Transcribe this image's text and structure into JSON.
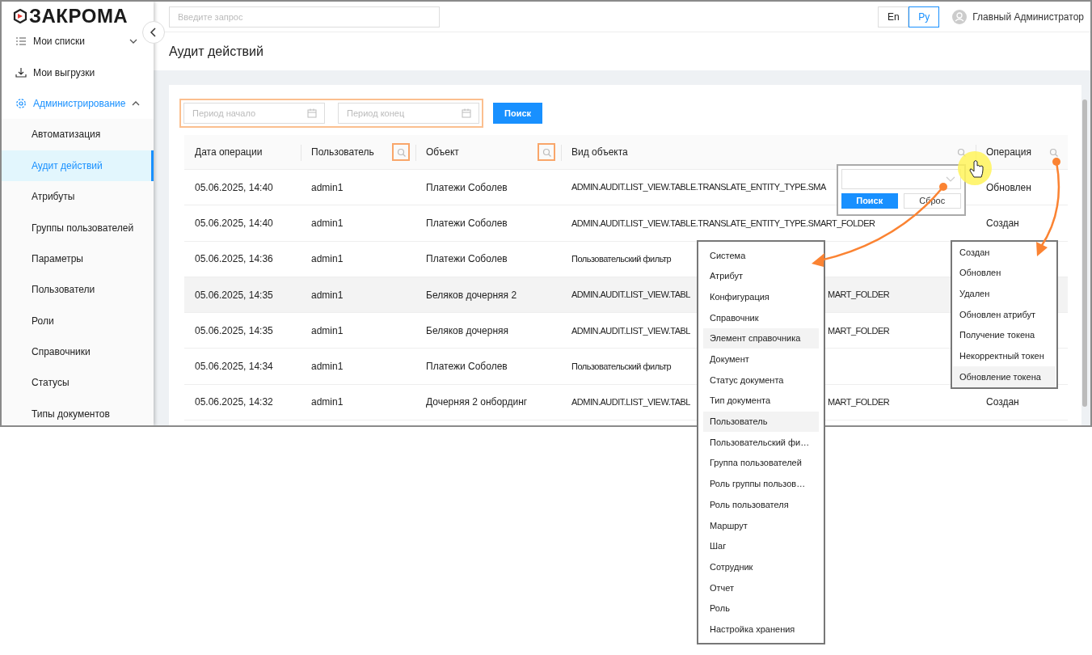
{
  "app": {
    "logo": "ЗАКРОМА"
  },
  "header": {
    "search": {
      "placeholder": "Введите запрос"
    },
    "languages": [
      {
        "label": "En",
        "selected": false
      },
      {
        "label": "Ру",
        "selected": true
      }
    ],
    "user": "Главный Администратор"
  },
  "sidebar": {
    "items": [
      {
        "label": "Мои списки",
        "kind": "list",
        "expanded": false,
        "selected": false
      },
      {
        "label": "Мои выгрузки",
        "kind": "download",
        "selected": false
      },
      {
        "label": "Администрирование",
        "kind": "gear",
        "expanded": true,
        "selected": true,
        "children": [
          {
            "label": "Автоматизация",
            "selected": false
          },
          {
            "label": "Аудит действий",
            "selected": true
          },
          {
            "label": "Атрибуты",
            "selected": false
          },
          {
            "label": "Группы пользователей",
            "selected": false
          },
          {
            "label": "Параметры",
            "selected": false
          },
          {
            "label": "Пользователи",
            "selected": false
          },
          {
            "label": "Роли",
            "selected": false
          },
          {
            "label": "Справочники",
            "selected": false
          },
          {
            "label": "Статусы",
            "selected": false
          },
          {
            "label": "Типы документов",
            "selected": false
          }
        ]
      }
    ]
  },
  "page": {
    "title": "Аудит действий"
  },
  "filters": {
    "marked": true,
    "start": {
      "placeholder": "Период начало"
    },
    "end": {
      "placeholder": "Период конец"
    },
    "search_button": "Поиск"
  },
  "table": {
    "columns": [
      {
        "label": "Дата операции",
        "filter": false
      },
      {
        "label": "Пользователь",
        "filter": true,
        "marked": true
      },
      {
        "label": "Объект",
        "filter": true,
        "marked": true
      },
      {
        "label": "Вид объекта",
        "filter": true,
        "marked": false
      },
      {
        "label": "Операция",
        "filter": true,
        "marked": false
      }
    ],
    "rows": [
      {
        "hovered": false,
        "cells": [
          "05.06.2025, 14:40",
          "admin1",
          "Платежи Соболев",
          "ADMIN.AUDIT.LIST_VIEW.TABLE.TRANSLATE_ENTITY_TYPE.SMA",
          "Обновлен"
        ]
      },
      {
        "hovered": false,
        "cells": [
          "05.06.2025, 14:40",
          "admin1",
          "Платежи Соболев",
          "ADMIN.AUDIT.LIST_VIEW.TABLE.TRANSLATE_ENTITY_TYPE.SMART_FOLDER",
          "Создан"
        ]
      },
      {
        "hovered": false,
        "cells": [
          "05.06.2025, 14:36",
          "admin1",
          "Платежи Соболев",
          "Пользовательский фильтр"
        ]
      },
      {
        "hovered": true,
        "cells": [
          "05.06.2025, 14:35",
          "admin1",
          "Беляков дочерняя 2",
          "ADMIN.AUDIT.LIST_VIEW.TABL"
        ],
        "type_tail": "MART_FOLDER"
      },
      {
        "hovered": false,
        "cells": [
          "05.06.2025, 14:35",
          "admin1",
          "Беляков дочерняя",
          "ADMIN.AUDIT.LIST_VIEW.TABL"
        ],
        "type_tail": "MART_FOLDER"
      },
      {
        "hovered": false,
        "cells": [
          "05.06.2025, 14:34",
          "admin1",
          "Платежи Соболев",
          "Пользовательский фильтр"
        ]
      },
      {
        "hovered": false,
        "cells": [
          "05.06.2025, 14:32",
          "admin1",
          "Дочерняя 2 онбординг",
          "ADMIN.AUDIT.LIST_VIEW.TABL",
          "Создан"
        ],
        "type_tail": "MART_FOLDER"
      }
    ]
  },
  "column_filter_popup": {
    "search_button": "Поиск",
    "reset_button": "Сброс"
  },
  "object_type_dropdown": {
    "items": [
      {
        "label": "Система",
        "hovered": false
      },
      {
        "label": "Атрибут",
        "hovered": false
      },
      {
        "label": "Конфигурация",
        "hovered": false
      },
      {
        "label": "Справочник",
        "hovered": false
      },
      {
        "label": "Элемент справочника",
        "hovered": true
      },
      {
        "label": "Документ",
        "hovered": false
      },
      {
        "label": "Статус документа",
        "hovered": false
      },
      {
        "label": "Тип документа",
        "hovered": false
      },
      {
        "label": "Пользователь",
        "hovered": true
      },
      {
        "label": "Пользовательский фи…",
        "hovered": false
      },
      {
        "label": "Группа пользователей",
        "hovered": false
      },
      {
        "label": "Роль группы пользов…",
        "hovered": false
      },
      {
        "label": "Роль пользователя",
        "hovered": false
      },
      {
        "label": "Маршрут",
        "hovered": false
      },
      {
        "label": "Шаг",
        "hovered": false
      },
      {
        "label": "Сотрудник",
        "hovered": false
      },
      {
        "label": "Отчет",
        "hovered": false
      },
      {
        "label": "Роль",
        "hovered": false
      },
      {
        "label": "Настройка хранения",
        "hovered": false
      }
    ]
  },
  "operation_dropdown": {
    "items": [
      {
        "label": "Создан",
        "hovered": false
      },
      {
        "label": "Обновлен",
        "hovered": false
      },
      {
        "label": "Удален",
        "hovered": false
      },
      {
        "label": "Обновлен атрибут",
        "hovered": false
      },
      {
        "label": "Получение токена",
        "hovered": false
      },
      {
        "label": "Некорректный токен",
        "hovered": false
      },
      {
        "label": "Обновление токена",
        "hovered": true
      }
    ]
  }
}
